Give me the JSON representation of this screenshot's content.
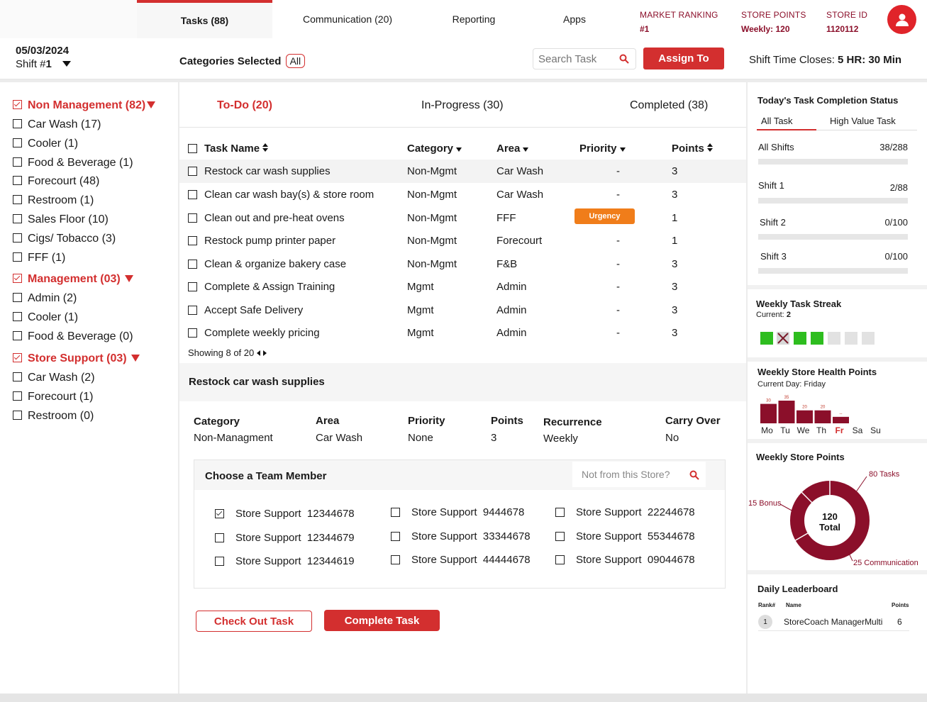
{
  "tabs": [
    {
      "label": "Tasks (88)"
    },
    {
      "label": "Communication (20)"
    },
    {
      "label": "Reporting"
    },
    {
      "label": "Apps"
    }
  ],
  "header_stats": {
    "market_ranking_label": "MARKET RANKING",
    "market_ranking_value": "#1",
    "store_points_label": "STORE POINTS",
    "store_points_value": "Weekly: 120",
    "store_id_label": "STORE ID",
    "store_id_value": "1120112"
  },
  "subbar": {
    "date": "05/03/2024",
    "shift_label": "Shift #",
    "shift_value": "1",
    "categories_label": "Categories Selected",
    "categories_value": "All",
    "search_placeholder": "Search Task",
    "assign_button": "Assign To",
    "shift_close_label": "Shift Time Closes:",
    "shift_close_value": "5 HR: 30 Min"
  },
  "sidebar": {
    "groups": [
      {
        "label": "Non Management (82)",
        "items": [
          "Car Wash (17)",
          "Cooler (1)",
          "Food & Beverage (1)",
          "Forecourt (48)",
          "Restroom (1)",
          "Sales Floor (10)",
          "Cigs/ Tobacco (3)",
          "FFF (1)"
        ]
      },
      {
        "label": "Management (03)",
        "items": [
          "Admin (2)",
          "Cooler (1)",
          "Food & Beverage (0)"
        ]
      },
      {
        "label": "Store Support (03)",
        "items": [
          "Car Wash (2)",
          "Forecourt (1)",
          "Restroom (0)"
        ]
      }
    ]
  },
  "status_tabs": [
    {
      "label": "To-Do (20)"
    },
    {
      "label": "In-Progress (30)"
    },
    {
      "label": "Completed (38)"
    }
  ],
  "table": {
    "headers": [
      "Task Name",
      "Category",
      "Area",
      "Priority",
      "Points"
    ],
    "rows": [
      {
        "name": "Restock car wash supplies",
        "category": "Non-Mgmt",
        "area": "Car Wash",
        "priority": "-",
        "points": "3"
      },
      {
        "name": "Clean car wash bay(s) & store room",
        "category": "Non-Mgmt",
        "area": "Car Wash",
        "priority": "-",
        "points": "3"
      },
      {
        "name": "Clean out and pre-heat ovens",
        "category": "Non-Mgmt",
        "area": "FFF",
        "priority": "Urgency",
        "points": "1"
      },
      {
        "name": "Restock pump printer paper",
        "category": "Non-Mgmt",
        "area": "Forecourt",
        "priority": "-",
        "points": "1"
      },
      {
        "name": "Clean & organize bakery case",
        "category": "Non-Mgmt",
        "area": "F&B",
        "priority": "-",
        "points": "3"
      },
      {
        "name": "Complete & Assign Training",
        "category": "Mgmt",
        "area": "Admin",
        "priority": "-",
        "points": "3"
      },
      {
        "name": "Accept Safe Delivery",
        "category": "Mgmt",
        "area": "Admin",
        "priority": "-",
        "points": "3"
      },
      {
        "name": "Complete weekly pricing",
        "category": "Mgmt",
        "area": "Admin",
        "priority": "-",
        "points": "3"
      }
    ],
    "showing": "Showing 8 of 20"
  },
  "detail": {
    "title": "Restock car wash supplies",
    "fields": [
      {
        "label": "Category",
        "value": "Non-Managment"
      },
      {
        "label": "Area",
        "value": "Car Wash"
      },
      {
        "label": "Priority",
        "value": "None"
      },
      {
        "label": "Points",
        "value": "3"
      },
      {
        "label": "Recurrence",
        "value": "Weekly"
      },
      {
        "label": "Carry Over",
        "value": "No"
      }
    ],
    "team_title": "Choose a Team Member",
    "team_search_placeholder": "Not from this Store?",
    "members": [
      {
        "name": "Store Support",
        "id": "12344678",
        "checked": true
      },
      {
        "name": "Store Support",
        "id": "9444678",
        "checked": false
      },
      {
        "name": "Store Support",
        "id": "22244678",
        "checked": false
      },
      {
        "name": "Store Support",
        "id": "12344679",
        "checked": false
      },
      {
        "name": "Store Support",
        "id": "33344678",
        "checked": false
      },
      {
        "name": "Store Support",
        "id": "55344678",
        "checked": false
      },
      {
        "name": "Store Support",
        "id": "12344619",
        "checked": false
      },
      {
        "name": "Store Support",
        "id": "44444678",
        "checked": false
      },
      {
        "name": "Store Support",
        "id": "09044678",
        "checked": false
      }
    ],
    "check_out_button": "Check Out Task",
    "complete_button": "Complete Task"
  },
  "completion": {
    "title": "Today's Task Completion Status",
    "tabs": [
      "All Task",
      "High Value Task"
    ],
    "rows": [
      {
        "label": "All Shifts",
        "value": "38/288"
      },
      {
        "label": "Shift 1",
        "value": "2/88"
      },
      {
        "label": "Shift 2",
        "value": "0/100"
      },
      {
        "label": "Shift 3",
        "value": "0/100"
      }
    ]
  },
  "streak": {
    "title": "Weekly Task Streak",
    "current_label": "Current:",
    "current_value": "2",
    "days": [
      "done",
      "missed",
      "done",
      "done",
      "empty",
      "empty",
      "empty"
    ]
  },
  "health": {
    "title": "Weekly Store Health Points",
    "subtitle": "Current Day: Friday",
    "days": [
      "Mo",
      "Tu",
      "We",
      "Th",
      "Fr",
      "Sa",
      "Su"
    ],
    "values": [
      30,
      35,
      20,
      20,
      10,
      0,
      0
    ],
    "value_labels": [
      "30",
      "35",
      "20",
      "20",
      "--",
      "",
      ""
    ],
    "current_index": 4
  },
  "store_points": {
    "title": "Weekly Store Points",
    "center_value": "120",
    "center_label": "Total",
    "segments": [
      {
        "label": "80 Tasks",
        "value": 80
      },
      {
        "label": "25 Communication",
        "value": 25
      },
      {
        "label": "15 Bonus",
        "value": 15
      }
    ]
  },
  "leaderboard": {
    "title": "Daily Leaderboard",
    "headers": [
      "Rank#",
      "Name",
      "Points"
    ],
    "rows": [
      {
        "rank": "1",
        "name": "StoreCoach ManagerMulti",
        "points": "6"
      }
    ]
  },
  "colors": {
    "accent": "#d32f2f",
    "maroon": "#8b0f2a",
    "urgency": "#f07d1a",
    "streak_done": "#2ebd1f"
  }
}
